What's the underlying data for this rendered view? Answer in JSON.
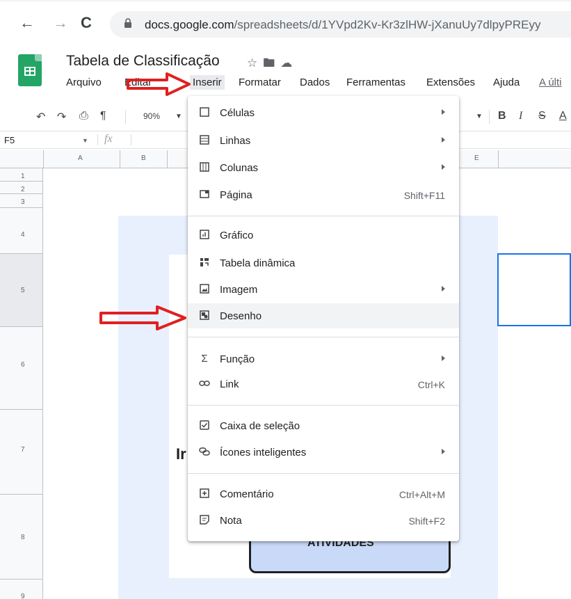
{
  "browser": {
    "url_host": "docs.google.com",
    "url_path": "/spreadsheets/d/1YVpd2Kv-Kr3zlHW-jXanuUy7dlpyPREyy"
  },
  "doc": {
    "title": "Tabela de Classificação"
  },
  "menubar": {
    "arquivo": "Arquivo",
    "editar": "Editar",
    "inserir": "Inserir",
    "formatar": "Formatar",
    "dados": "Dados",
    "ferramentas": "Ferramentas",
    "extensoes": "Extensões",
    "ajuda": "Ajuda",
    "ultima": "A últi"
  },
  "toolbar": {
    "zoom": "90%"
  },
  "formula": {
    "cellref": "F5",
    "fx": "fx"
  },
  "columns": [
    "A",
    "B",
    "E"
  ],
  "rows": [
    "1",
    "2",
    "3",
    "4",
    "5",
    "6",
    "7",
    "8",
    "9"
  ],
  "sheet": {
    "big_text": "Ir",
    "button_text": "ATIVIDADES"
  },
  "menu": {
    "items": [
      {
        "label": "Células",
        "shortcut": "",
        "submenu": true,
        "icon": "square-outline-icon"
      },
      {
        "label": "Linhas",
        "shortcut": "",
        "submenu": true,
        "icon": "rows-icon"
      },
      {
        "label": "Colunas",
        "shortcut": "",
        "submenu": true,
        "icon": "columns-icon"
      },
      {
        "label": "Página",
        "shortcut": "Shift+F11",
        "submenu": false,
        "icon": "page-icon"
      },
      {
        "label": "Gráfico",
        "shortcut": "",
        "submenu": false,
        "icon": "chart-icon"
      },
      {
        "label": "Tabela dinâmica",
        "shortcut": "",
        "submenu": false,
        "icon": "pivot-table-icon"
      },
      {
        "label": "Imagem",
        "shortcut": "",
        "submenu": true,
        "icon": "image-icon"
      },
      {
        "label": "Desenho",
        "shortcut": "",
        "submenu": false,
        "icon": "drawing-icon"
      },
      {
        "label": "Função",
        "shortcut": "",
        "submenu": true,
        "icon": "sigma-icon"
      },
      {
        "label": "Link",
        "shortcut": "Ctrl+K",
        "submenu": false,
        "icon": "link-icon"
      },
      {
        "label": "Caixa de seleção",
        "shortcut": "",
        "submenu": false,
        "icon": "checkbox-icon"
      },
      {
        "label": "Ícones inteligentes",
        "shortcut": "",
        "submenu": true,
        "icon": "smart-chips-icon"
      },
      {
        "label": "Comentário",
        "shortcut": "Ctrl+Alt+M",
        "submenu": false,
        "icon": "comment-icon"
      },
      {
        "label": "Nota",
        "shortcut": "Shift+F2",
        "submenu": false,
        "icon": "note-icon"
      }
    ]
  },
  "colors": {
    "accent": "#1a73e8",
    "sheets_green": "#23a566",
    "annotation_red": "#e02020",
    "button_fill": "#c9daf8"
  }
}
